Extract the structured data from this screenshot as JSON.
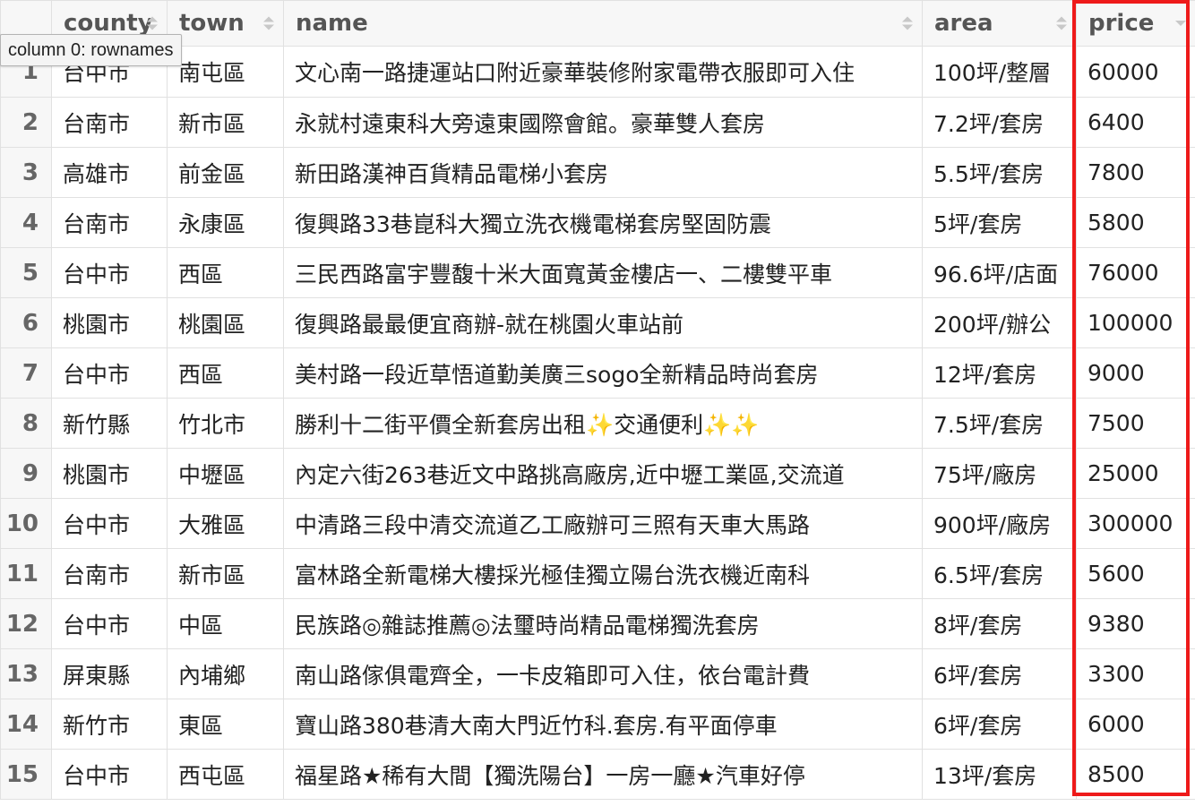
{
  "columns": {
    "rownames": "",
    "county": "county",
    "town": "town",
    "name": "name",
    "area": "area",
    "price": "price"
  },
  "tooltip": "column 0: rownames",
  "rows": [
    {
      "id": "1",
      "county": "台中市",
      "town": "南屯區",
      "name": "文心南一路捷運站口附近豪華裝修附家電帶衣服即可入住",
      "area": "100坪/整層",
      "price": "60000"
    },
    {
      "id": "2",
      "county": "台南市",
      "town": "新市區",
      "name": "永就村遠東科大旁遠東國際會館。豪華雙人套房",
      "area": "7.2坪/套房",
      "price": "6400"
    },
    {
      "id": "3",
      "county": "高雄市",
      "town": "前金區",
      "name": "新田路漢神百貨精品電梯小套房",
      "area": "5.5坪/套房",
      "price": "7800"
    },
    {
      "id": "4",
      "county": "台南市",
      "town": "永康區",
      "name": "復興路33巷崑科大獨立洗衣機電梯套房堅固防震",
      "area": "5坪/套房",
      "price": "5800"
    },
    {
      "id": "5",
      "county": "台中市",
      "town": "西區",
      "name": "三民西路富宇豐馥十米大面寬黃金樓店一、二樓雙平車",
      "area": "96.6坪/店面",
      "price": "76000"
    },
    {
      "id": "6",
      "county": "桃園市",
      "town": "桃園區",
      "name": "復興路最最便宜商辦-就在桃園火車站前",
      "area": "200坪/辦公",
      "price": "100000"
    },
    {
      "id": "7",
      "county": "台中市",
      "town": "西區",
      "name": "美村路一段近草悟道勤美廣三sogo全新精品時尚套房",
      "area": "12坪/套房",
      "price": "9000"
    },
    {
      "id": "8",
      "county": "新竹縣",
      "town": "竹北市",
      "name": "勝利十二街平價全新套房出租✨交通便利✨✨",
      "area": "7.5坪/套房",
      "price": "7500"
    },
    {
      "id": "9",
      "county": "桃園市",
      "town": "中壢區",
      "name": "內定六街263巷近文中路挑高廠房,近中壢工業區,交流道",
      "area": "75坪/廠房",
      "price": "25000"
    },
    {
      "id": "10",
      "county": "台中市",
      "town": "大雅區",
      "name": "中清路三段中清交流道乙工廠辦可三照有天車大馬路",
      "area": "900坪/廠房",
      "price": "300000"
    },
    {
      "id": "11",
      "county": "台南市",
      "town": "新市區",
      "name": "富林路全新電梯大樓採光極佳獨立陽台洗衣機近南科",
      "area": "6.5坪/套房",
      "price": "5600"
    },
    {
      "id": "12",
      "county": "台中市",
      "town": "中區",
      "name": "民族路◎雜誌推薦◎法璽時尚精品電梯獨洗套房",
      "area": "8坪/套房",
      "price": "9380"
    },
    {
      "id": "13",
      "county": "屏東縣",
      "town": "內埔鄉",
      "name": "南山路傢俱電齊全，一卡皮箱即可入住，依台電計費",
      "area": "6坪/套房",
      "price": "3300"
    },
    {
      "id": "14",
      "county": "新竹市",
      "town": "東區",
      "name": "寶山路380巷清大南大門近竹科.套房.有平面停車",
      "area": "6坪/套房",
      "price": "6000"
    },
    {
      "id": "15",
      "county": "台中市",
      "town": "西屯區",
      "name": "福星路★稀有大間【獨洗陽台】一房一廳★汽車好停",
      "area": "13坪/套房",
      "price": "8500"
    }
  ],
  "colors": {
    "highlight": "#ee1a1a",
    "header_bg": "#f7f7f7",
    "border": "#e1e1e1"
  }
}
